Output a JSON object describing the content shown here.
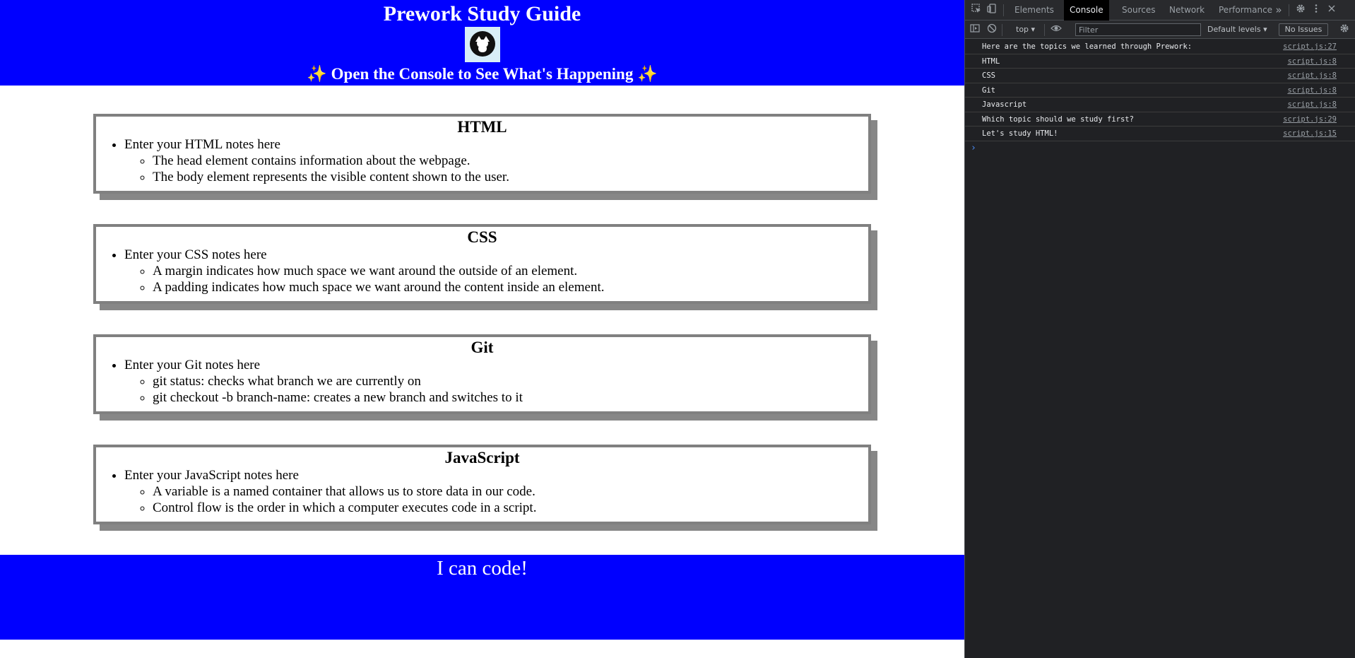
{
  "page": {
    "header": {
      "title": "Prework Study Guide",
      "subtitle_left_emoji": "✨",
      "subtitle": "Open the Console to See What's Happening",
      "subtitle_right_emoji": "✨",
      "bg_color": "#0000ff"
    },
    "cards": [
      {
        "title": "HTML",
        "notes_label": "Enter your HTML notes here",
        "notes": [
          "The head element contains information about the webpage.",
          "The body element represents the visible content shown to the user."
        ]
      },
      {
        "title": "CSS",
        "notes_label": "Enter your CSS notes here",
        "notes": [
          "A margin indicates how much space we want around the outside of an element.",
          "A padding indicates how much space we want around the content inside an element."
        ]
      },
      {
        "title": "Git",
        "notes_label": "Enter your Git notes here",
        "notes": [
          "git status: checks what branch we are currently on",
          "git checkout -b branch-name: creates a new branch and switches to it"
        ]
      },
      {
        "title": "JavaScript",
        "notes_label": "Enter your JavaScript notes here",
        "notes": [
          "A variable is a named container that allows us to store data in our code.",
          "Control flow is the order in which a computer executes code in a script."
        ]
      }
    ],
    "footer": {
      "text": "I can code!"
    }
  },
  "devtools": {
    "tabs": [
      "Elements",
      "Console",
      "Sources",
      "Network",
      "Performance"
    ],
    "active_tab": "Console",
    "more_tabs_icon": "»",
    "toolbar": {
      "context": "top",
      "filter_placeholder": "Filter",
      "levels": "Default levels",
      "issues": "No Issues"
    },
    "console_messages": [
      {
        "text": "Here are the topics we learned through Prework:",
        "source": "script.js:27"
      },
      {
        "text": "HTML",
        "source": "script.js:8"
      },
      {
        "text": "CSS",
        "source": "script.js:8"
      },
      {
        "text": "Git",
        "source": "script.js:8"
      },
      {
        "text": "Javascript",
        "source": "script.js:8"
      },
      {
        "text": "Which topic should we study first?",
        "source": "script.js:29"
      },
      {
        "text": "Let's study HTML!",
        "source": "script.js:15"
      }
    ],
    "prompt_symbol": "›",
    "colors": {
      "background": "#202124",
      "active_tab": "#000000",
      "prompt": "#4c8ef7"
    }
  }
}
